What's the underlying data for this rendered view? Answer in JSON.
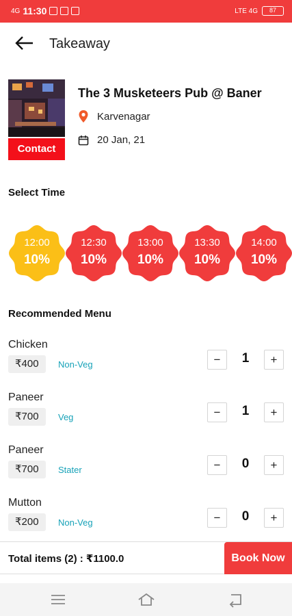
{
  "status_bar": {
    "signal": "4G",
    "time": "11:30",
    "right_indicators": "LTE 4G",
    "battery": "87"
  },
  "header": {
    "title": "Takeaway"
  },
  "restaurant": {
    "name": "The 3 Musketeers Pub @ Baner",
    "location": "Karvenagar",
    "date": "20 Jan, 21",
    "contact_label": "Contact"
  },
  "time_section": {
    "title": "Select Time",
    "slots": [
      {
        "time": "12:00",
        "discount": "10%",
        "selected": true
      },
      {
        "time": "12:30",
        "discount": "10%",
        "selected": false
      },
      {
        "time": "13:00",
        "discount": "10%",
        "selected": false
      },
      {
        "time": "13:30",
        "discount": "10%",
        "selected": false
      },
      {
        "time": "14:00",
        "discount": "10%",
        "selected": false
      }
    ]
  },
  "menu_section": {
    "title": "Recommended Menu",
    "items": [
      {
        "name": "Chicken",
        "price": "₹400",
        "tag": "Non-Veg",
        "qty": "1"
      },
      {
        "name": "Paneer",
        "price": "₹700",
        "tag": "Veg",
        "qty": "1"
      },
      {
        "name": "Paneer",
        "price": "₹700",
        "tag": "Stater",
        "qty": "0"
      },
      {
        "name": "Mutton",
        "price": "₹200",
        "tag": "Non-Veg",
        "qty": "0"
      }
    ]
  },
  "footer": {
    "total": "Total items (2) : ₹1100.0",
    "book_label": "Book Now"
  },
  "colors": {
    "accent": "#f03c3c",
    "selected_slot": "#fbbf17",
    "tag": "#17a2b8"
  },
  "icons": {
    "back": "arrow-left-icon",
    "location": "map-pin-icon",
    "date": "calendar-icon",
    "minus": "minus-icon",
    "plus": "plus-icon",
    "nav_menu": "menu-icon",
    "nav_home": "home-icon",
    "nav_back": "back-icon"
  }
}
